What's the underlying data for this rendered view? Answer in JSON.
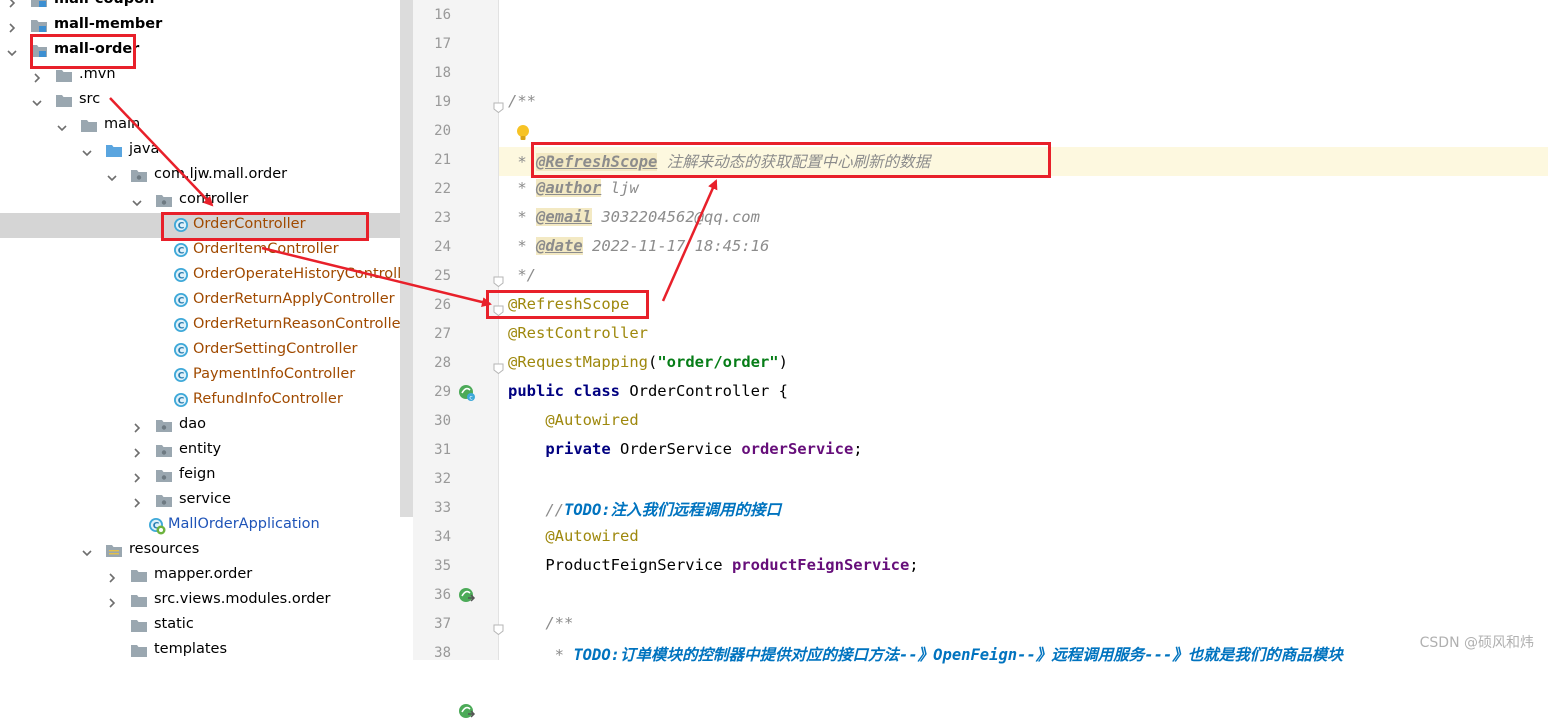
{
  "project_tree": {
    "items": [
      {
        "label": "mall-coupon",
        "icon": "module-folder-icon",
        "expanded": false,
        "bold": true
      },
      {
        "label": "mall-member",
        "icon": "module-folder-icon",
        "expanded": false,
        "bold": true
      },
      {
        "label": "mall-order",
        "icon": "module-folder-icon",
        "expanded": true,
        "bold": true
      },
      {
        "label": ".mvn",
        "icon": "folder-icon",
        "expanded": false
      },
      {
        "label": "src",
        "icon": "folder-icon",
        "expanded": true
      },
      {
        "label": "main",
        "icon": "folder-icon",
        "expanded": true
      },
      {
        "label": "java",
        "icon": "source-folder-icon",
        "expanded": true
      },
      {
        "label": "com.ljw.mall.order",
        "icon": "package-icon",
        "expanded": true
      },
      {
        "label": "controller",
        "icon": "package-icon",
        "expanded": true
      },
      {
        "label": "OrderController",
        "icon": "class-icon",
        "selected": true
      },
      {
        "label": "OrderItemController",
        "icon": "class-icon"
      },
      {
        "label": "OrderOperateHistoryControll",
        "icon": "class-icon"
      },
      {
        "label": "OrderReturnApplyController",
        "icon": "class-icon"
      },
      {
        "label": "OrderReturnReasonControlle",
        "icon": "class-icon"
      },
      {
        "label": "OrderSettingController",
        "icon": "class-icon"
      },
      {
        "label": "PaymentInfoController",
        "icon": "class-icon"
      },
      {
        "label": "RefundInfoController",
        "icon": "class-icon"
      },
      {
        "label": "dao",
        "icon": "package-icon",
        "expanded": false
      },
      {
        "label": "entity",
        "icon": "package-icon",
        "expanded": false
      },
      {
        "label": "feign",
        "icon": "package-icon",
        "expanded": false
      },
      {
        "label": "service",
        "icon": "package-icon",
        "expanded": false
      },
      {
        "label": "MallOrderApplication",
        "icon": "spring-boot-class-icon"
      },
      {
        "label": "resources",
        "icon": "resources-folder-icon",
        "expanded": true
      },
      {
        "label": "mapper.order",
        "icon": "folder-icon",
        "expanded": false
      },
      {
        "label": "src.views.modules.order",
        "icon": "folder-icon",
        "expanded": false
      },
      {
        "label": "static",
        "icon": "folder-icon"
      },
      {
        "label": "templates",
        "icon": "folder-icon"
      }
    ]
  },
  "editor": {
    "lines": [
      {
        "n": "16",
        "tokens": []
      },
      {
        "n": "17",
        "tokens": []
      },
      {
        "n": "18",
        "tokens": []
      },
      {
        "n": "19",
        "tokens": [
          {
            "t": "/**",
            "c": "cmt"
          }
        ]
      },
      {
        "n": "20",
        "tokens": []
      },
      {
        "n": "21",
        "tokens": [
          {
            "t": " * ",
            "c": "cmt"
          },
          {
            "t": "@RefreshScope",
            "c": "tag"
          },
          {
            "t": " 注解来动态的获取配置中心刷新的数据",
            "c": "cmt"
          }
        ]
      },
      {
        "n": "22",
        "tokens": [
          {
            "t": " * ",
            "c": "cmt"
          },
          {
            "t": "@author",
            "c": "tag"
          },
          {
            "t": " ljw",
            "c": "cmt"
          }
        ]
      },
      {
        "n": "23",
        "tokens": [
          {
            "t": " * ",
            "c": "cmt"
          },
          {
            "t": "@email",
            "c": "tag"
          },
          {
            "t": " 3032204562@qq.com",
            "c": "cmt"
          }
        ]
      },
      {
        "n": "24",
        "tokens": [
          {
            "t": " * ",
            "c": "cmt"
          },
          {
            "t": "@date",
            "c": "tag"
          },
          {
            "t": " 2022-11-17 18:45:16",
            "c": "cmt"
          }
        ]
      },
      {
        "n": "25",
        "tokens": [
          {
            "t": " */",
            "c": "cmt"
          }
        ]
      },
      {
        "n": "26",
        "tokens": [
          {
            "t": "@RefreshScope",
            "c": "ann"
          }
        ]
      },
      {
        "n": "27",
        "tokens": [
          {
            "t": "@RestController",
            "c": "ann"
          }
        ]
      },
      {
        "n": "28",
        "tokens": [
          {
            "t": "@RequestMapping",
            "c": "ann"
          },
          {
            "t": "(",
            "c": ""
          },
          {
            "t": "\"order/order\"",
            "c": "str"
          },
          {
            "t": ")",
            "c": ""
          }
        ]
      },
      {
        "n": "29",
        "tokens": [
          {
            "t": "public class",
            "c": "kw"
          },
          {
            "t": " OrderController {",
            "c": ""
          }
        ]
      },
      {
        "n": "30",
        "tokens": [
          {
            "t": "    ",
            "c": ""
          },
          {
            "t": "@Autowired",
            "c": "ann"
          }
        ]
      },
      {
        "n": "31",
        "tokens": [
          {
            "t": "    ",
            "c": ""
          },
          {
            "t": "private",
            "c": "kw"
          },
          {
            "t": " OrderService ",
            "c": ""
          },
          {
            "t": "orderService",
            "c": "fld"
          },
          {
            "t": ";",
            "c": ""
          }
        ]
      },
      {
        "n": "32",
        "tokens": []
      },
      {
        "n": "33",
        "tokens": [
          {
            "t": "    //",
            "c": "cmt"
          },
          {
            "t": "TODO:注入我们远程调用的接口",
            "c": "todo"
          }
        ]
      },
      {
        "n": "34",
        "tokens": [
          {
            "t": "    ",
            "c": ""
          },
          {
            "t": "@Autowired",
            "c": "ann"
          }
        ]
      },
      {
        "n": "35",
        "tokens": [
          {
            "t": "    ProductFeignService ",
            "c": ""
          },
          {
            "t": "productFeignService",
            "c": "fld"
          },
          {
            "t": ";",
            "c": ""
          }
        ]
      },
      {
        "n": "36",
        "tokens": []
      },
      {
        "n": "37",
        "tokens": [
          {
            "t": "    /**",
            "c": "cmt"
          }
        ]
      },
      {
        "n": "38",
        "tokens": [
          {
            "t": "     * ",
            "c": "cmt"
          },
          {
            "t": "TODO:订单模块的控制器中提供对应的接口方法--》OpenFeign--》远程调用服务---》也就是我们的商品模块",
            "c": "todo"
          }
        ]
      }
    ]
  },
  "watermark": "CSDN @硕风和炜",
  "colors": {
    "annotation_box": "#e8202a",
    "current_line": "#fdf8df",
    "selection": "#d5d5d5"
  }
}
